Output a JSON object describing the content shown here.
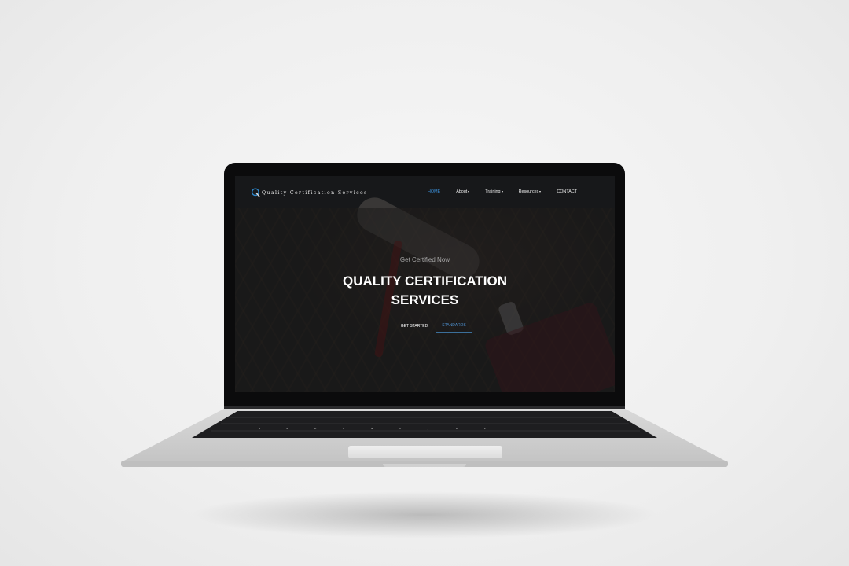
{
  "site": {
    "brand": "Quality Certification Services",
    "nav": [
      {
        "label": "HOME",
        "active": true,
        "dropdown": false
      },
      {
        "label": "About",
        "active": false,
        "dropdown": true
      },
      {
        "label": "Training",
        "active": false,
        "dropdown": true
      },
      {
        "label": "Resources",
        "active": false,
        "dropdown": true
      },
      {
        "label": "CONTACT",
        "active": false,
        "dropdown": false
      }
    ]
  },
  "hero": {
    "kicker": "Get Certified Now",
    "title_line1": "QUALITY CERTIFICATION",
    "title_line2": "SERVICES",
    "primary_button": "GET STARTED",
    "secondary_button": "STANDARDS"
  },
  "colors": {
    "accent": "#3b8fd9",
    "nav_bg": "#17181a",
    "button_border": "#3b6f9a"
  }
}
